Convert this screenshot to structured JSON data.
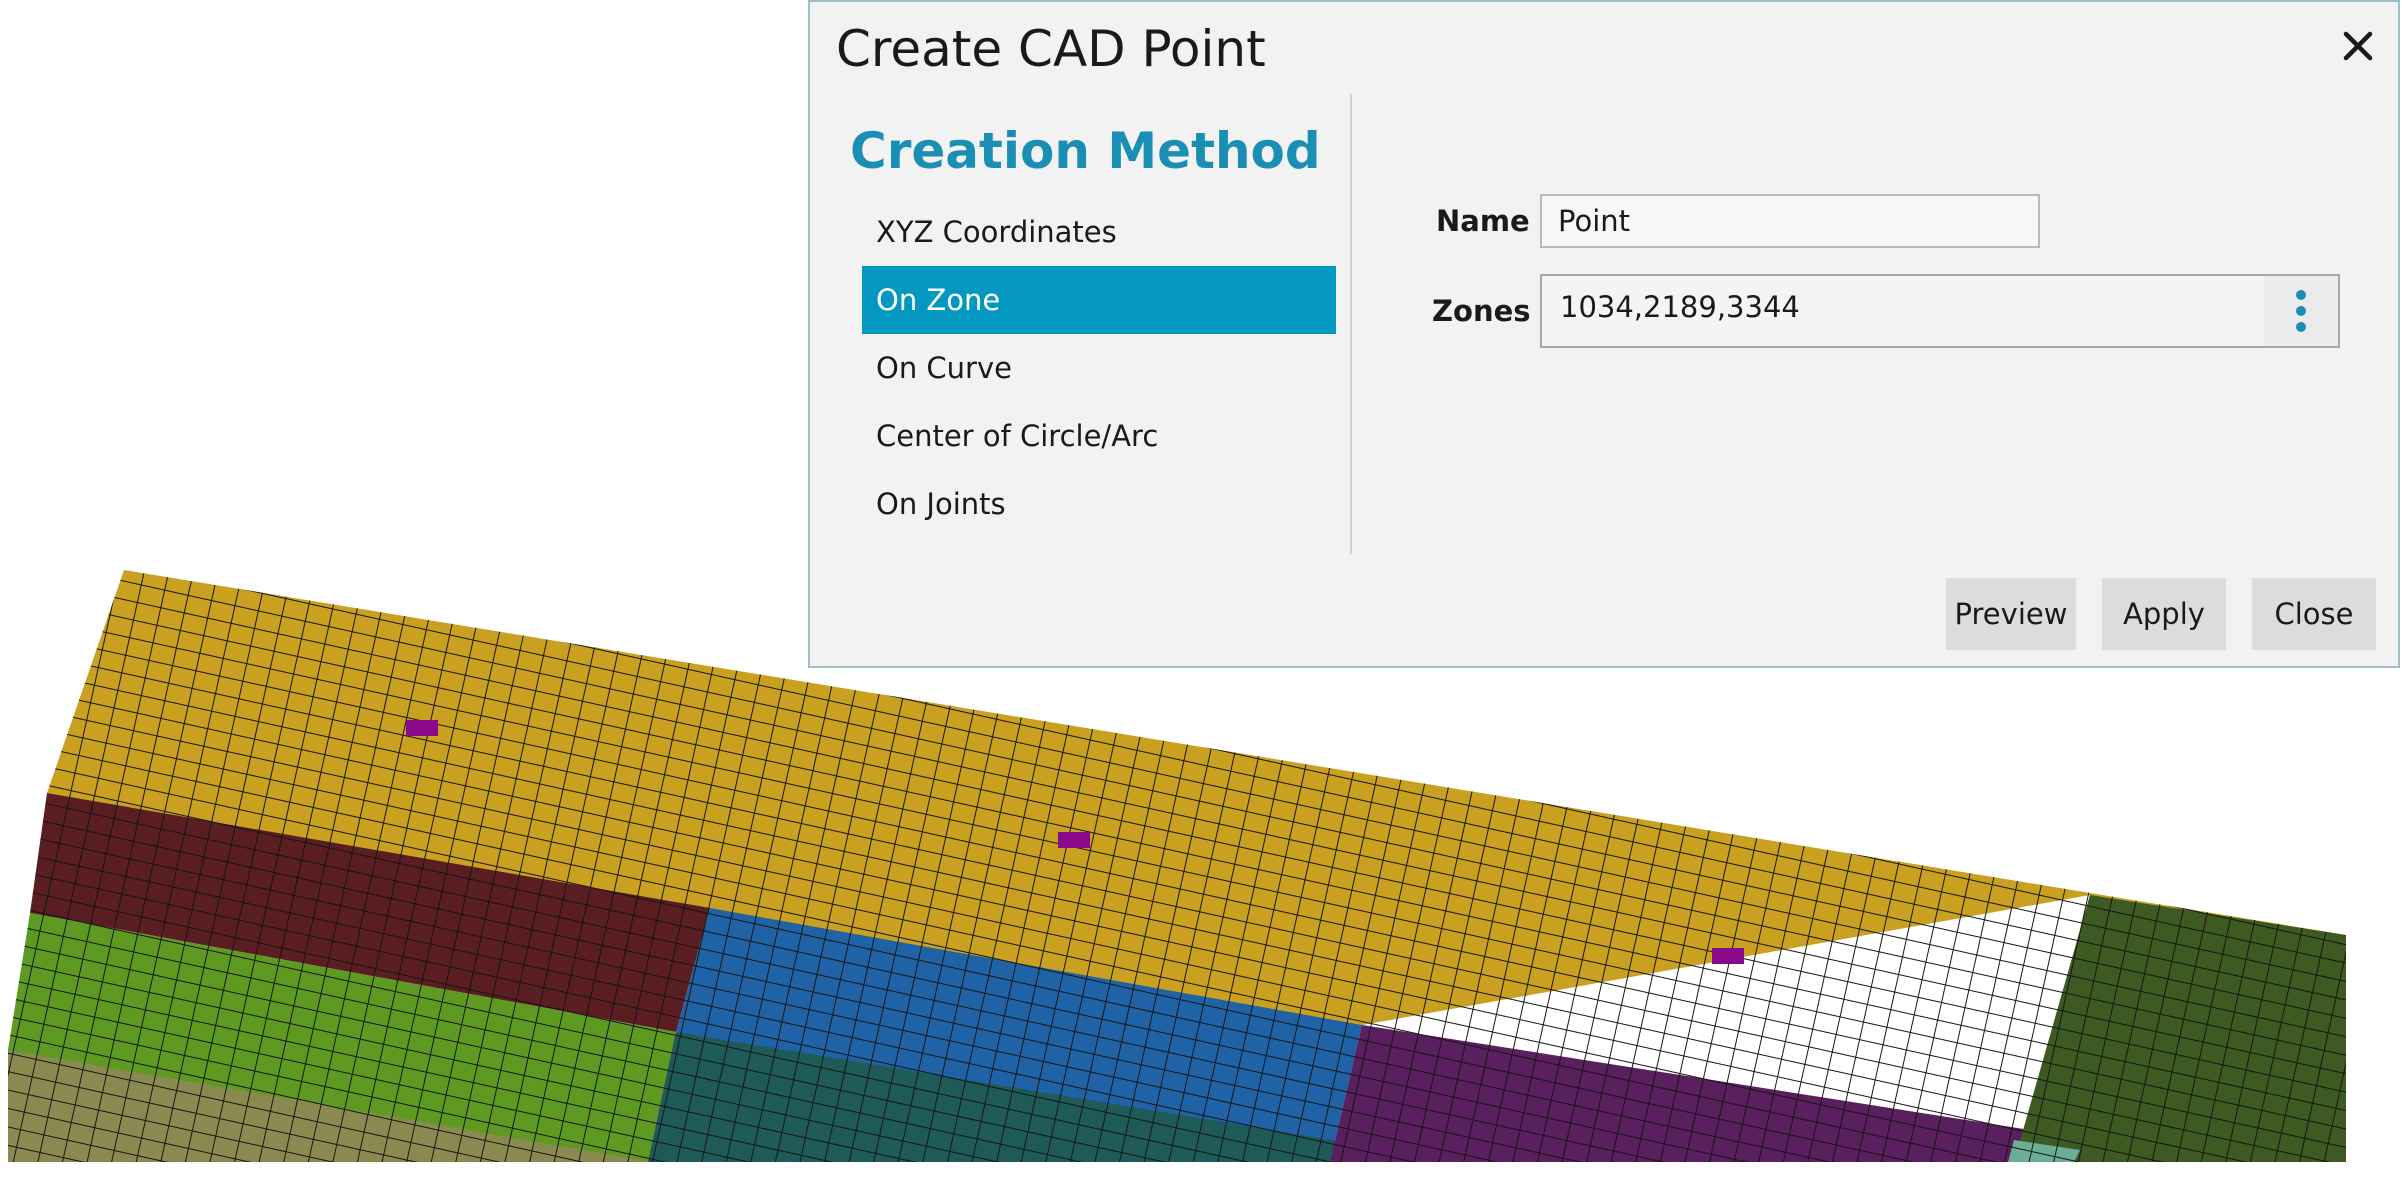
{
  "dialog": {
    "title": "Create CAD Point",
    "close_icon": "close-icon",
    "creation_method": {
      "heading": "Creation Method",
      "items": [
        {
          "label": "XYZ Coordinates",
          "selected": false
        },
        {
          "label": "On Zone",
          "selected": true
        },
        {
          "label": "On Curve",
          "selected": false
        },
        {
          "label": "Center of Circle/Arc",
          "selected": false
        },
        {
          "label": "On Joints",
          "selected": false
        }
      ]
    },
    "name_field": {
      "label": "Name",
      "value": "Point"
    },
    "zones_field": {
      "label": "Zones",
      "value": "1034,2189,3344",
      "menu_icon": "vertical-ellipsis-icon"
    },
    "buttons": {
      "preview": "Preview",
      "apply": "Apply",
      "close": "Close"
    }
  },
  "colors": {
    "accent": "#0498c0",
    "heading": "#1b8fb3",
    "zone_gold": "#c9a020",
    "zone_maroon": "#5a1e22",
    "zone_green": "#5e9a22",
    "zone_blue": "#1f62a6",
    "zone_teal": "#1d5a58",
    "zone_purple": "#5a1f5e",
    "zone_darkgreen": "#3c5a22",
    "zone_olive": "#8a8a50",
    "zone_lightteal": "#6aae98",
    "highlight_magenta": "#8a0a8a"
  }
}
